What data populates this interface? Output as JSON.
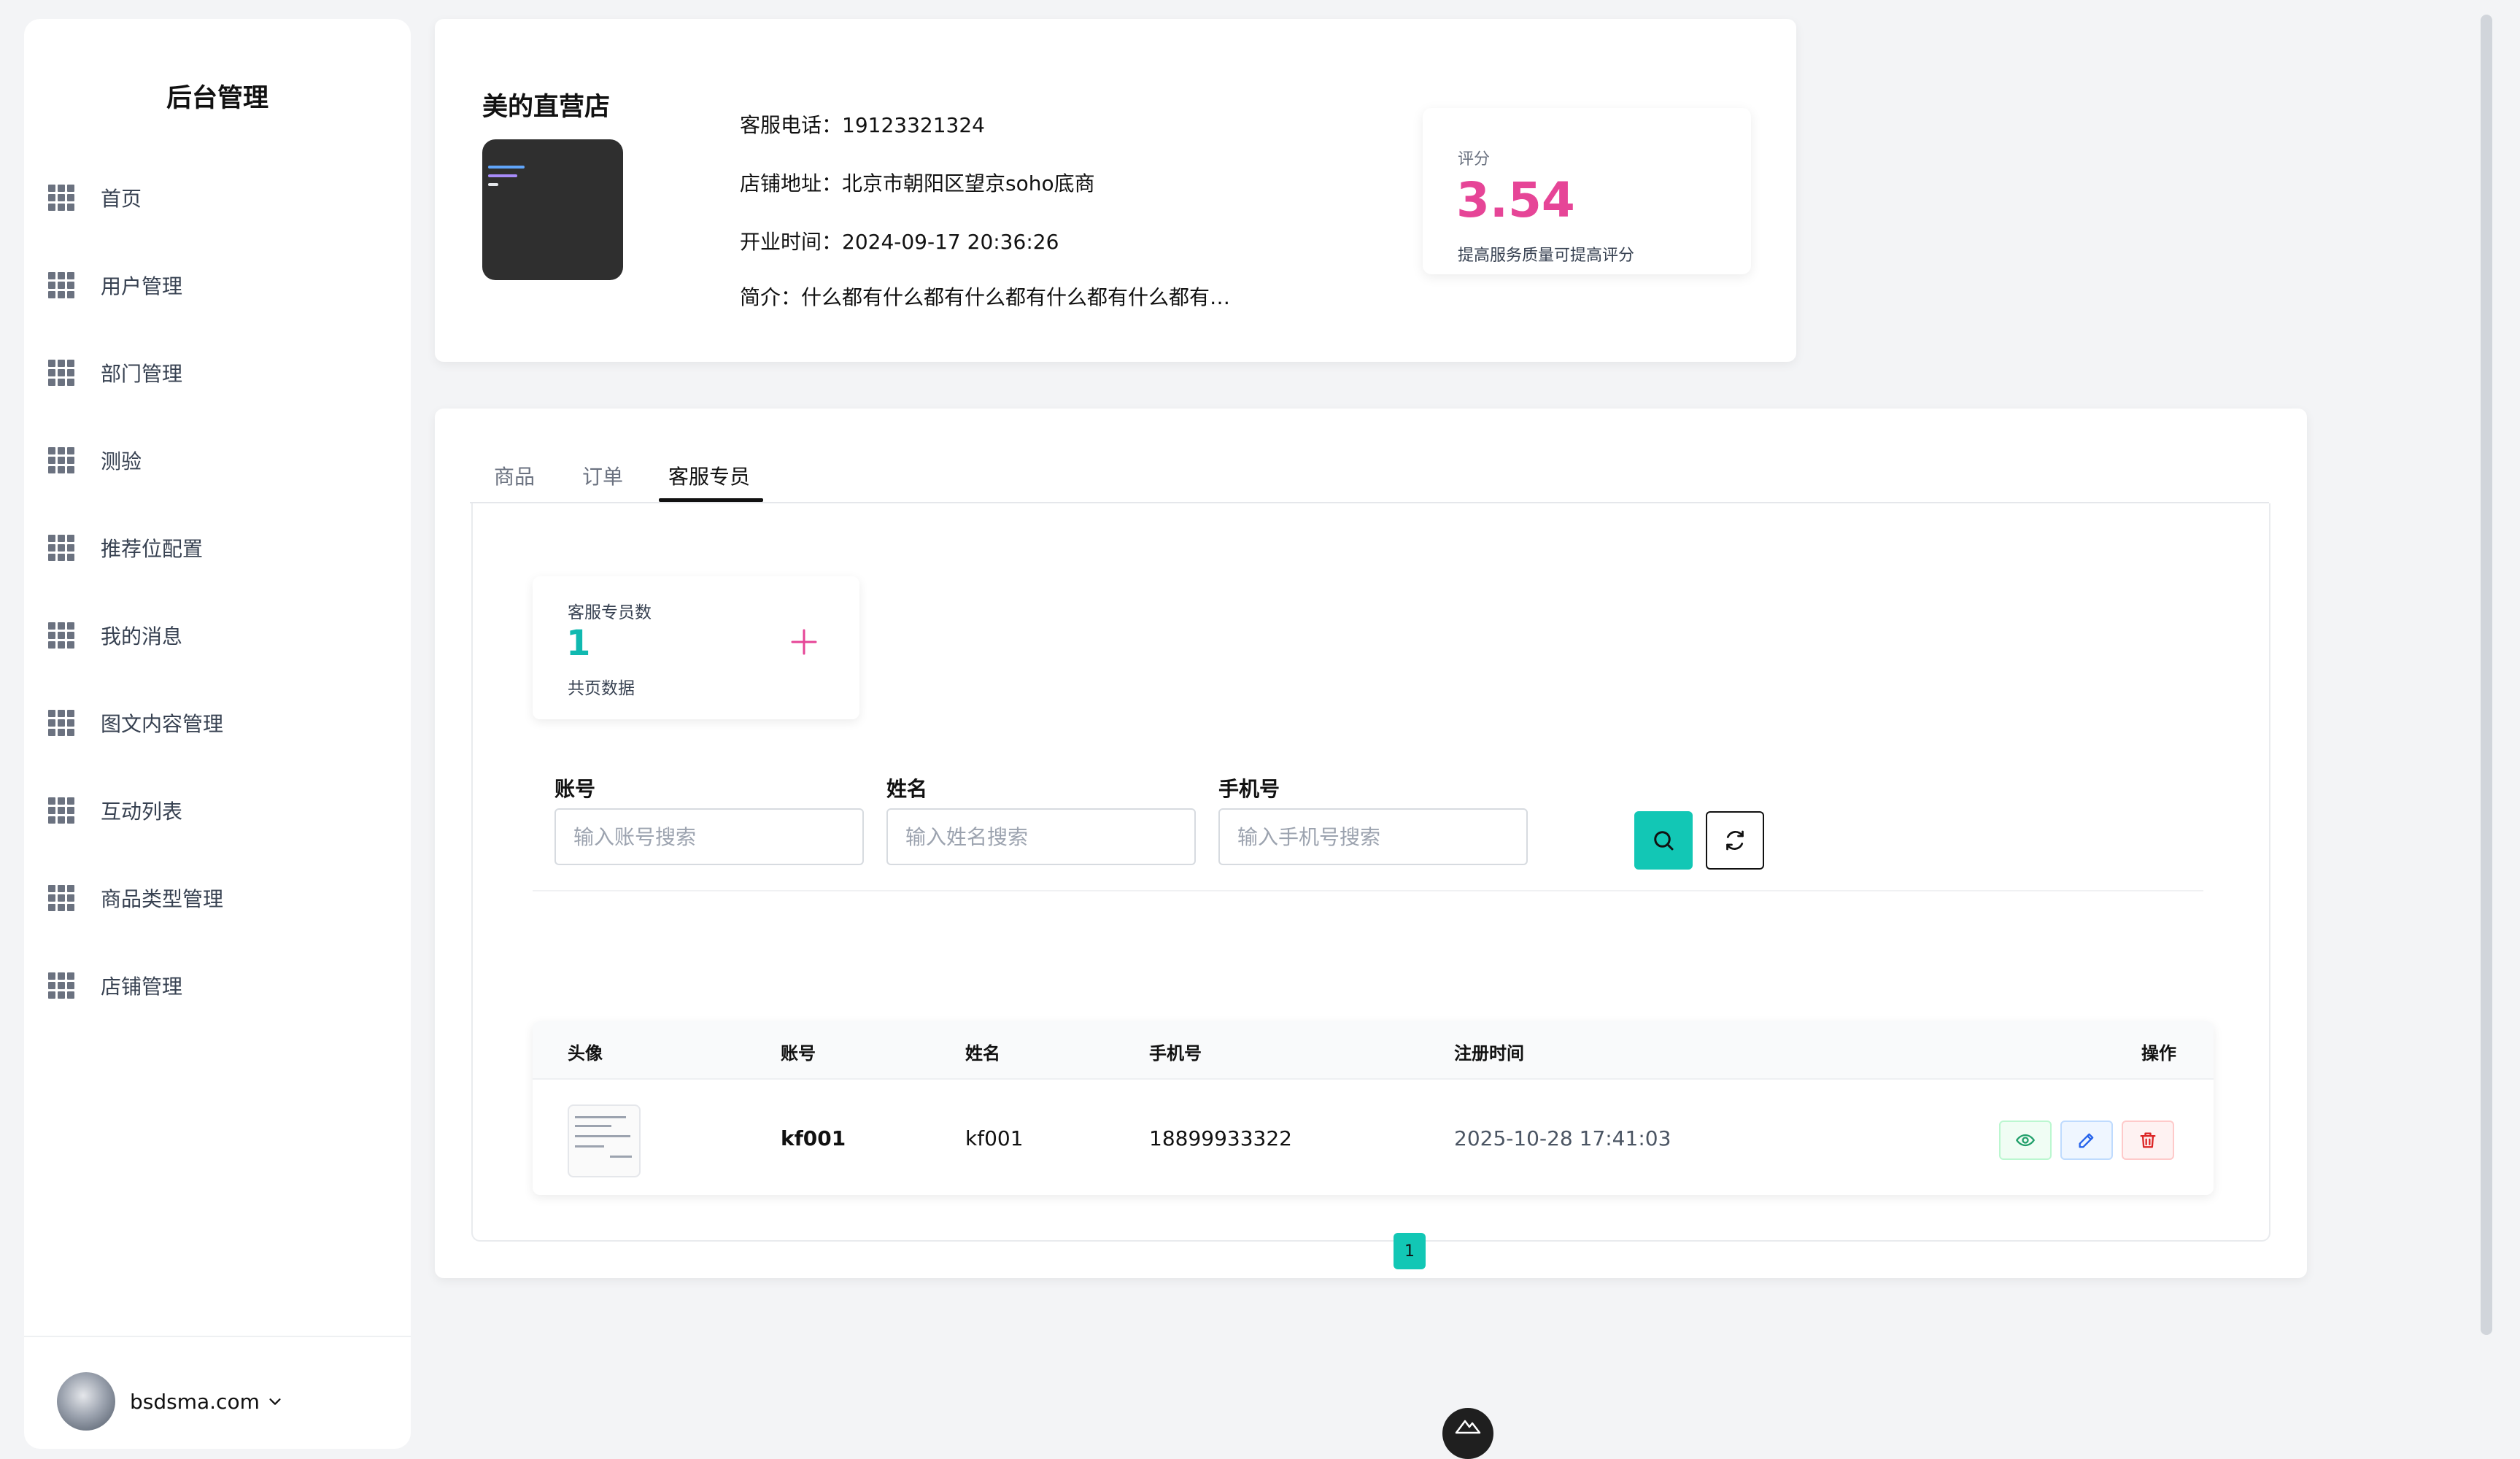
{
  "sidebar": {
    "brand": "后台管理",
    "items": [
      {
        "label": "首页"
      },
      {
        "label": "用户管理"
      },
      {
        "label": "部门管理"
      },
      {
        "label": "测验"
      },
      {
        "label": "推荐位配置"
      },
      {
        "label": "我的消息"
      },
      {
        "label": "图文内容管理"
      },
      {
        "label": "互动列表"
      },
      {
        "label": "商品类型管理"
      },
      {
        "label": "店铺管理"
      }
    ],
    "user": {
      "name": "bsdsma.com"
    }
  },
  "shop": {
    "name": "美的直营店",
    "phone": "客服电话：19123321324",
    "address": "店铺地址：北京市朝阳区望京soho底商",
    "open_time": "开业时间：2024-09-17 20:36:26",
    "intro": "简介：什么都有什么都有什么都有什么都有什么都有…",
    "rating": {
      "label": "评分",
      "value": "3.54",
      "tip": "提高服务质量可提高评分"
    }
  },
  "tabs": [
    {
      "label": "商品",
      "active": false
    },
    {
      "label": "订单",
      "active": false
    },
    {
      "label": "客服专员",
      "active": true
    }
  ],
  "stat": {
    "label": "客服专员数",
    "value": "1",
    "sub": "共页数据"
  },
  "filters": [
    {
      "label": "账号",
      "placeholder": "输入账号搜索",
      "value": ""
    },
    {
      "label": "姓名",
      "placeholder": "输入姓名搜索",
      "value": ""
    },
    {
      "label": "手机号",
      "placeholder": "输入手机号搜索",
      "value": ""
    }
  ],
  "table": {
    "columns": [
      "头像",
      "账号",
      "姓名",
      "手机号",
      "注册时间",
      "操作"
    ],
    "rows": [
      {
        "account": "kf001",
        "name": "kf001",
        "phone": "18899933322",
        "registered": "2025-10-28 17:41:03"
      }
    ]
  },
  "pagination": {
    "current": "1"
  },
  "colors": {
    "accent": "#12c7b5",
    "rating": "#e64597",
    "stat": "#10b9b0",
    "view": "#22a06b",
    "edit": "#2563eb",
    "delete": "#dc2626"
  }
}
